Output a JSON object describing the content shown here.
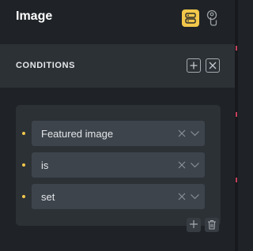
{
  "header": {
    "title": "Image",
    "toggle_icon": "layout-toggle-icon",
    "user_icon": "user-touch-icon"
  },
  "conditions": {
    "heading": "CONDITIONS",
    "add_icon": "plus-icon",
    "remove_icon": "close-icon",
    "rows": [
      {
        "value": "Featured image"
      },
      {
        "value": "is"
      },
      {
        "value": "set"
      }
    ],
    "row_add_icon": "plus-icon",
    "row_delete_icon": "trash-icon"
  },
  "colors": {
    "accent": "#f2c84b",
    "panel": "#1f2327",
    "section": "#2c3136",
    "field": "#3d444b"
  }
}
